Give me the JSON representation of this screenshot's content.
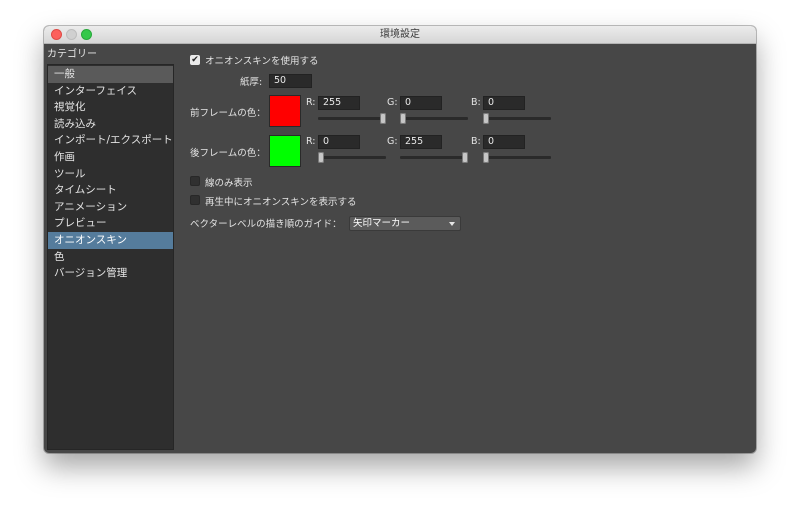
{
  "window": {
    "title": "環境設定"
  },
  "sidebar": {
    "header": "カテゴリー",
    "items": [
      {
        "label": "一般"
      },
      {
        "label": "インターフェイス"
      },
      {
        "label": "視覚化"
      },
      {
        "label": "読み込み"
      },
      {
        "label": "インポート/エクスポート"
      },
      {
        "label": "作画"
      },
      {
        "label": "ツール"
      },
      {
        "label": "タイムシート"
      },
      {
        "label": "アニメーション"
      },
      {
        "label": "プレビュー"
      },
      {
        "label": "オニオンスキン"
      },
      {
        "label": "色"
      },
      {
        "label": "バージョン管理"
      }
    ],
    "selected_index": 10
  },
  "settings": {
    "use_onion_skin": {
      "label": "オニオンスキンを使用する",
      "checked": true,
      "mark": "✔"
    },
    "paper_thickness": {
      "label": "紙厚:",
      "value": "50"
    },
    "front_frame": {
      "label": "前フレームの色：",
      "color": "#ff0000",
      "r": {
        "label": "R:",
        "value": "255",
        "fraction": 1.0
      },
      "g": {
        "label": "G:",
        "value": "0",
        "fraction": 0.0
      },
      "b": {
        "label": "B:",
        "value": "0",
        "fraction": 0.0
      }
    },
    "back_frame": {
      "label": "後フレームの色：",
      "color": "#00ff00",
      "r": {
        "label": "R:",
        "value": "0",
        "fraction": 0.0
      },
      "g": {
        "label": "G:",
        "value": "255",
        "fraction": 1.0
      },
      "b": {
        "label": "B:",
        "value": "0",
        "fraction": 0.0
      }
    },
    "lines_only": {
      "label": "線のみ表示",
      "checked": false
    },
    "show_during_playback": {
      "label": "再生中にオニオンスキンを表示する",
      "checked": false
    },
    "vector_guide": {
      "label": "ベクターレベルの描き順のガイド：",
      "value": "矢印マーカー"
    }
  }
}
